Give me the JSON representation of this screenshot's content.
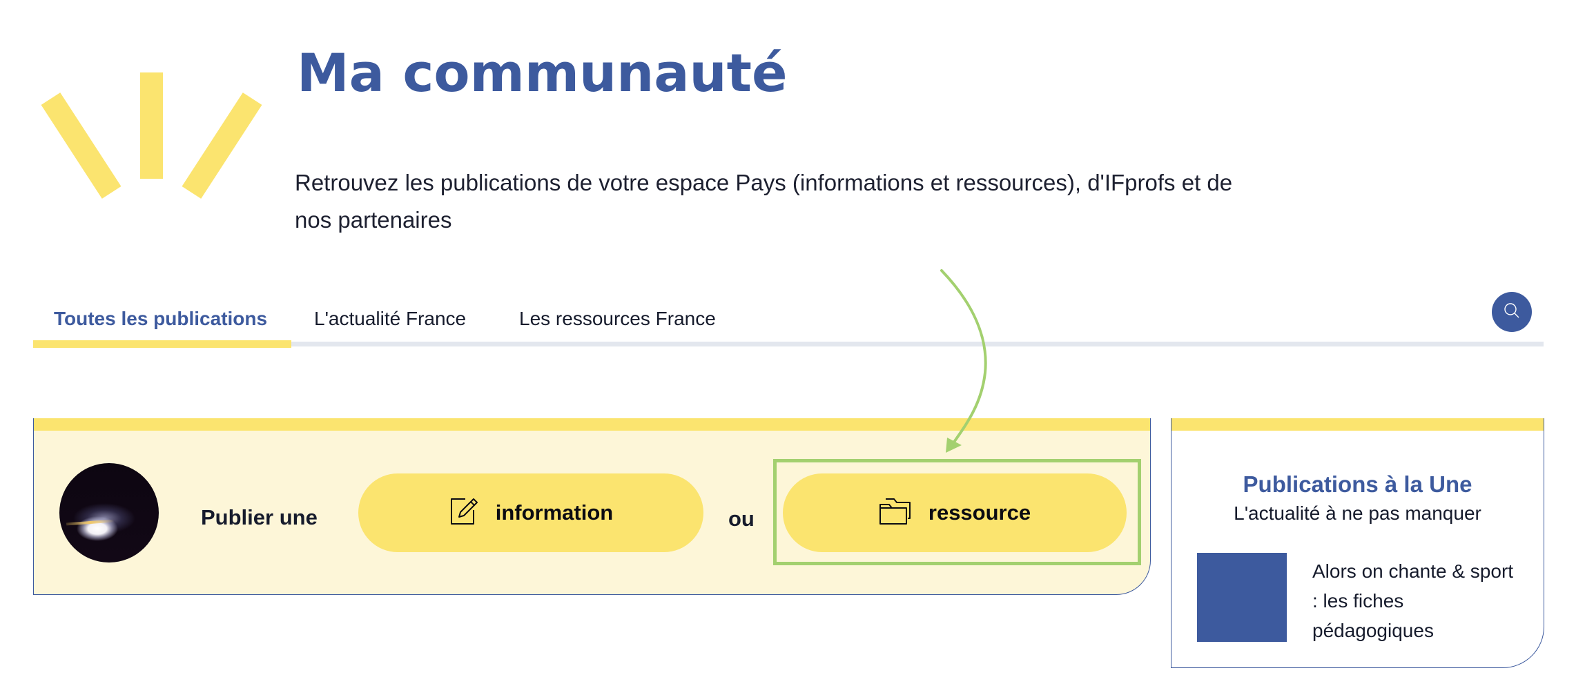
{
  "header": {
    "title": "Ma communauté",
    "intro": "Retrouvez les publications de votre espace Pays (informations et ressources), d'IFprofs et de nos partenaires"
  },
  "tabs": [
    {
      "label": "Toutes les publications",
      "active": true
    },
    {
      "label": "L'actualité France",
      "active": false
    },
    {
      "label": "Les ressources France",
      "active": false
    }
  ],
  "search": {
    "icon": "search-icon"
  },
  "publish": {
    "label": "Publier une",
    "or_label": "ou",
    "buttons": [
      {
        "label": "information",
        "icon": "edit-note-icon"
      },
      {
        "label": "ressource",
        "icon": "folder-icon"
      }
    ],
    "avatar": "user-avatar"
  },
  "featured": {
    "title": "Publications à la Une",
    "subtitle": "L'actualité à ne pas manquer",
    "items": [
      {
        "title": "Alors on chante & sport : les fiches pédagogiques"
      }
    ]
  },
  "annotation": {
    "target": "ressource",
    "color": "#a3d06f"
  },
  "colors": {
    "brand_blue": "#3d5a9e",
    "accent_yellow": "#fbe46f",
    "panel_bg": "#fdf6d8",
    "tab_line": "#e3e7ee"
  }
}
